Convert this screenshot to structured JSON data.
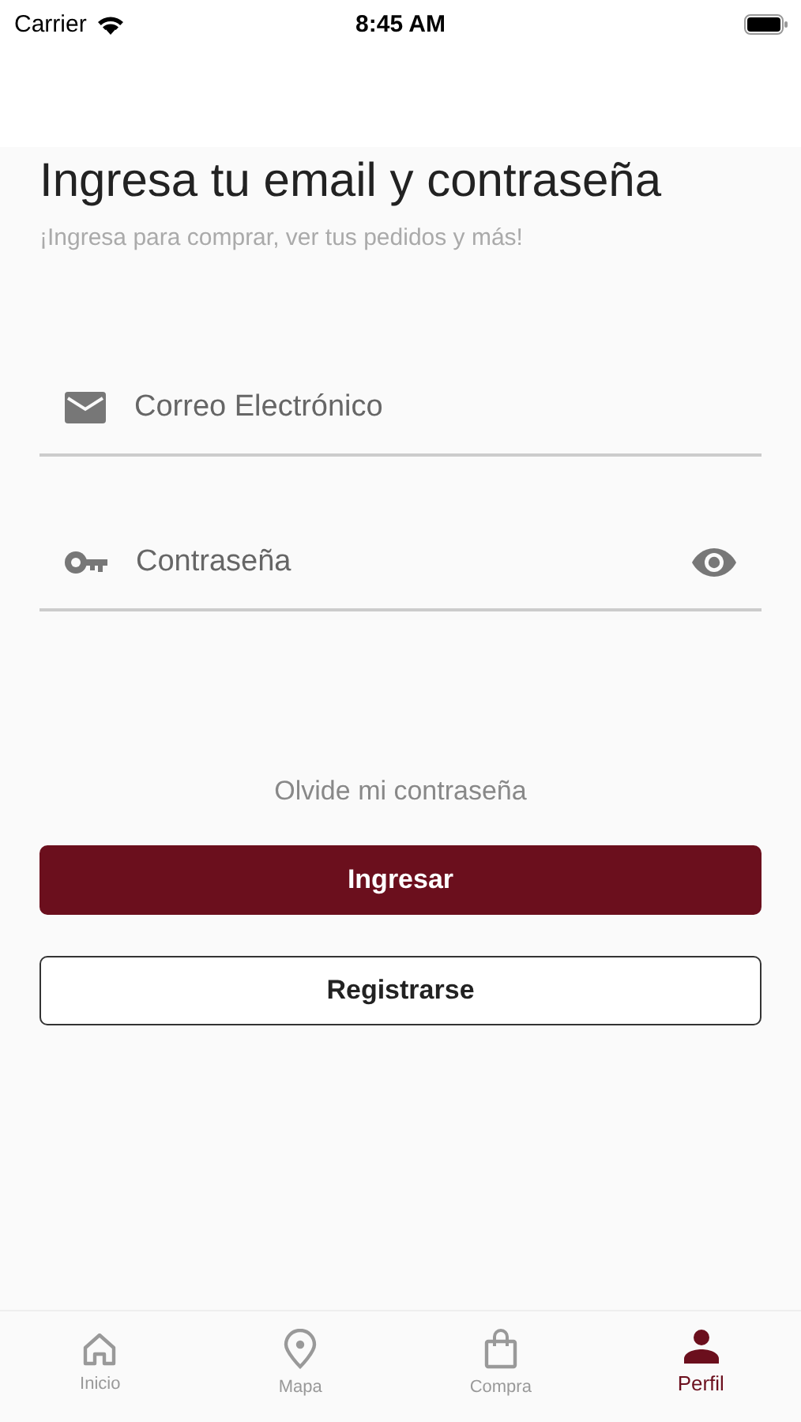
{
  "status_bar": {
    "carrier": "Carrier",
    "time": "8:45 AM"
  },
  "title": "Ingresa tu email y contraseña",
  "subtitle": "¡Ingresa para comprar, ver tus pedidos y más!",
  "fields": [
    {
      "kind": "email",
      "placeholder": "Correo Electrónico"
    },
    {
      "kind": "password",
      "placeholder": "Contraseña"
    }
  ],
  "forgot_link": "Olvide mi contraseña",
  "buttons": [
    {
      "kind": "primary",
      "label": "Ingresar"
    },
    {
      "kind": "outline",
      "label": "Registrarse"
    }
  ],
  "tabs": [
    {
      "kind": "home",
      "label": "Inicio",
      "selected": false
    },
    {
      "kind": "map",
      "label": "Mapa",
      "selected": false
    },
    {
      "kind": "bag",
      "label": "Compra",
      "selected": false
    },
    {
      "kind": "person",
      "label": "Perfil",
      "selected": true
    }
  ]
}
